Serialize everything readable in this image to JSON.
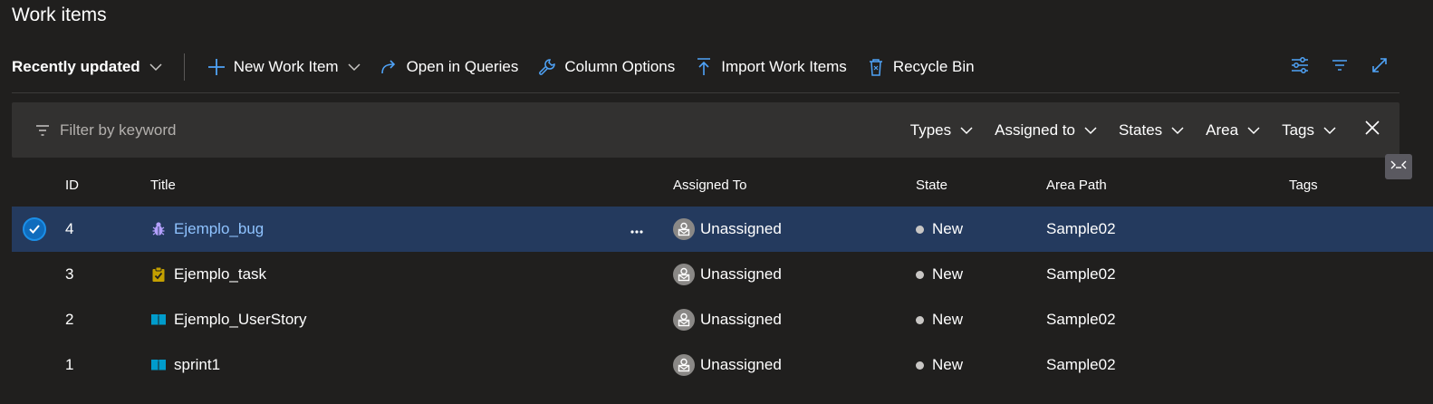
{
  "page": {
    "title": "Work items"
  },
  "toolbar": {
    "pivot_label": "Recently updated",
    "new_item_label": "New Work Item",
    "open_queries_label": "Open in Queries",
    "column_options_label": "Column Options",
    "import_label": "Import Work Items",
    "recycle_label": "Recycle Bin",
    "right_icons": [
      "view-options-icon",
      "filter-icon",
      "fullscreen-icon"
    ]
  },
  "filter": {
    "placeholder": "Filter by keyword",
    "dropdowns": [
      "Types",
      "Assigned to",
      "States",
      "Area",
      "Tags"
    ]
  },
  "grid": {
    "columns": {
      "id": "ID",
      "title": "Title",
      "assigned": "Assigned To",
      "state": "State",
      "area": "Area Path",
      "tags": "Tags"
    },
    "rows": [
      {
        "id": "4",
        "title": "Ejemplo_bug",
        "type_icon": "bug-icon",
        "assigned": "Unassigned",
        "state": "New",
        "area": "Sample02",
        "tags": "",
        "selected": true
      },
      {
        "id": "3",
        "title": "Ejemplo_task",
        "type_icon": "task-icon",
        "assigned": "Unassigned",
        "state": "New",
        "area": "Sample02",
        "tags": "",
        "selected": false
      },
      {
        "id": "2",
        "title": "Ejemplo_UserStory",
        "type_icon": "user-story-icon",
        "assigned": "Unassigned",
        "state": "New",
        "area": "Sample02",
        "tags": "",
        "selected": false
      },
      {
        "id": "1",
        "title": "sprint1",
        "type_icon": "user-story-icon",
        "assigned": "Unassigned",
        "state": "New",
        "area": "Sample02",
        "tags": "",
        "selected": false
      }
    ]
  },
  "colors": {
    "background": "#201f1e",
    "filter_bar": "#323130",
    "selected_row": "#243a5e",
    "accent": "#4fa3f7",
    "bug": "#b4a0ff",
    "task": "#c4a000",
    "user_story": "#009ccc"
  }
}
